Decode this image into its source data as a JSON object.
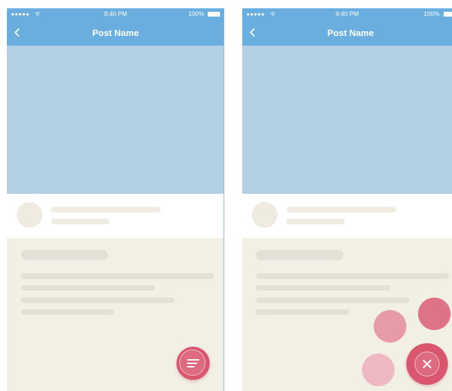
{
  "statusbar": {
    "signal": "●●●●●",
    "wifi": "ᯤ",
    "time": "9:40 PM",
    "battery": "100%"
  },
  "navbar": {
    "title": "Post Name"
  },
  "icons": {
    "back": "chevron-left-icon",
    "menu": "menu-lines-icon",
    "close": "close-icon"
  },
  "colors": {
    "header": "#6aaedf",
    "hero": "#b2cfe4",
    "background": "#f2efe5",
    "fab": "#d9566e"
  }
}
